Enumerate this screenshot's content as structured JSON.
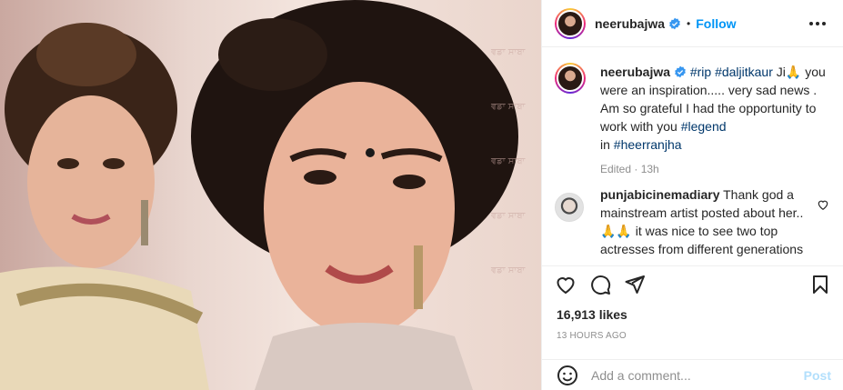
{
  "post": {
    "username": "neerubajwa",
    "separator": "•",
    "follow_label": "Follow"
  },
  "caption": {
    "username": "neerubajwa",
    "tags": {
      "rip": "#rip",
      "daljit": "#daljitkaur",
      "legend": "#legend",
      "heer": "#heerranjha"
    },
    "ji": " Ji🙏",
    "body_1": "you were an inspiration..... very sad news . Am so grateful I had the opportunity to work with you ",
    "in": "in ",
    "edited": "Edited · 13h"
  },
  "comment": {
    "username": "punjabicinemadiary",
    "text": "Thank god a mainstream artist posted about her.. 🙏🙏 it was nice to see two top actresses from different generations"
  },
  "stats": {
    "likes": "16,913 likes",
    "time": "13 HOURS AGO"
  },
  "composer": {
    "placeholder": "Add a comment...",
    "post_label": "Post"
  },
  "icons": {
    "like": "heart-icon",
    "comment": "comment-icon",
    "share": "send-icon",
    "save": "bookmark-icon",
    "emoji": "emoji-icon",
    "more": "more-options-icon",
    "verified": "verified-badge-icon"
  },
  "colors": {
    "link": "#0095f6",
    "tag": "#00376b",
    "muted": "#8e8e8e"
  }
}
